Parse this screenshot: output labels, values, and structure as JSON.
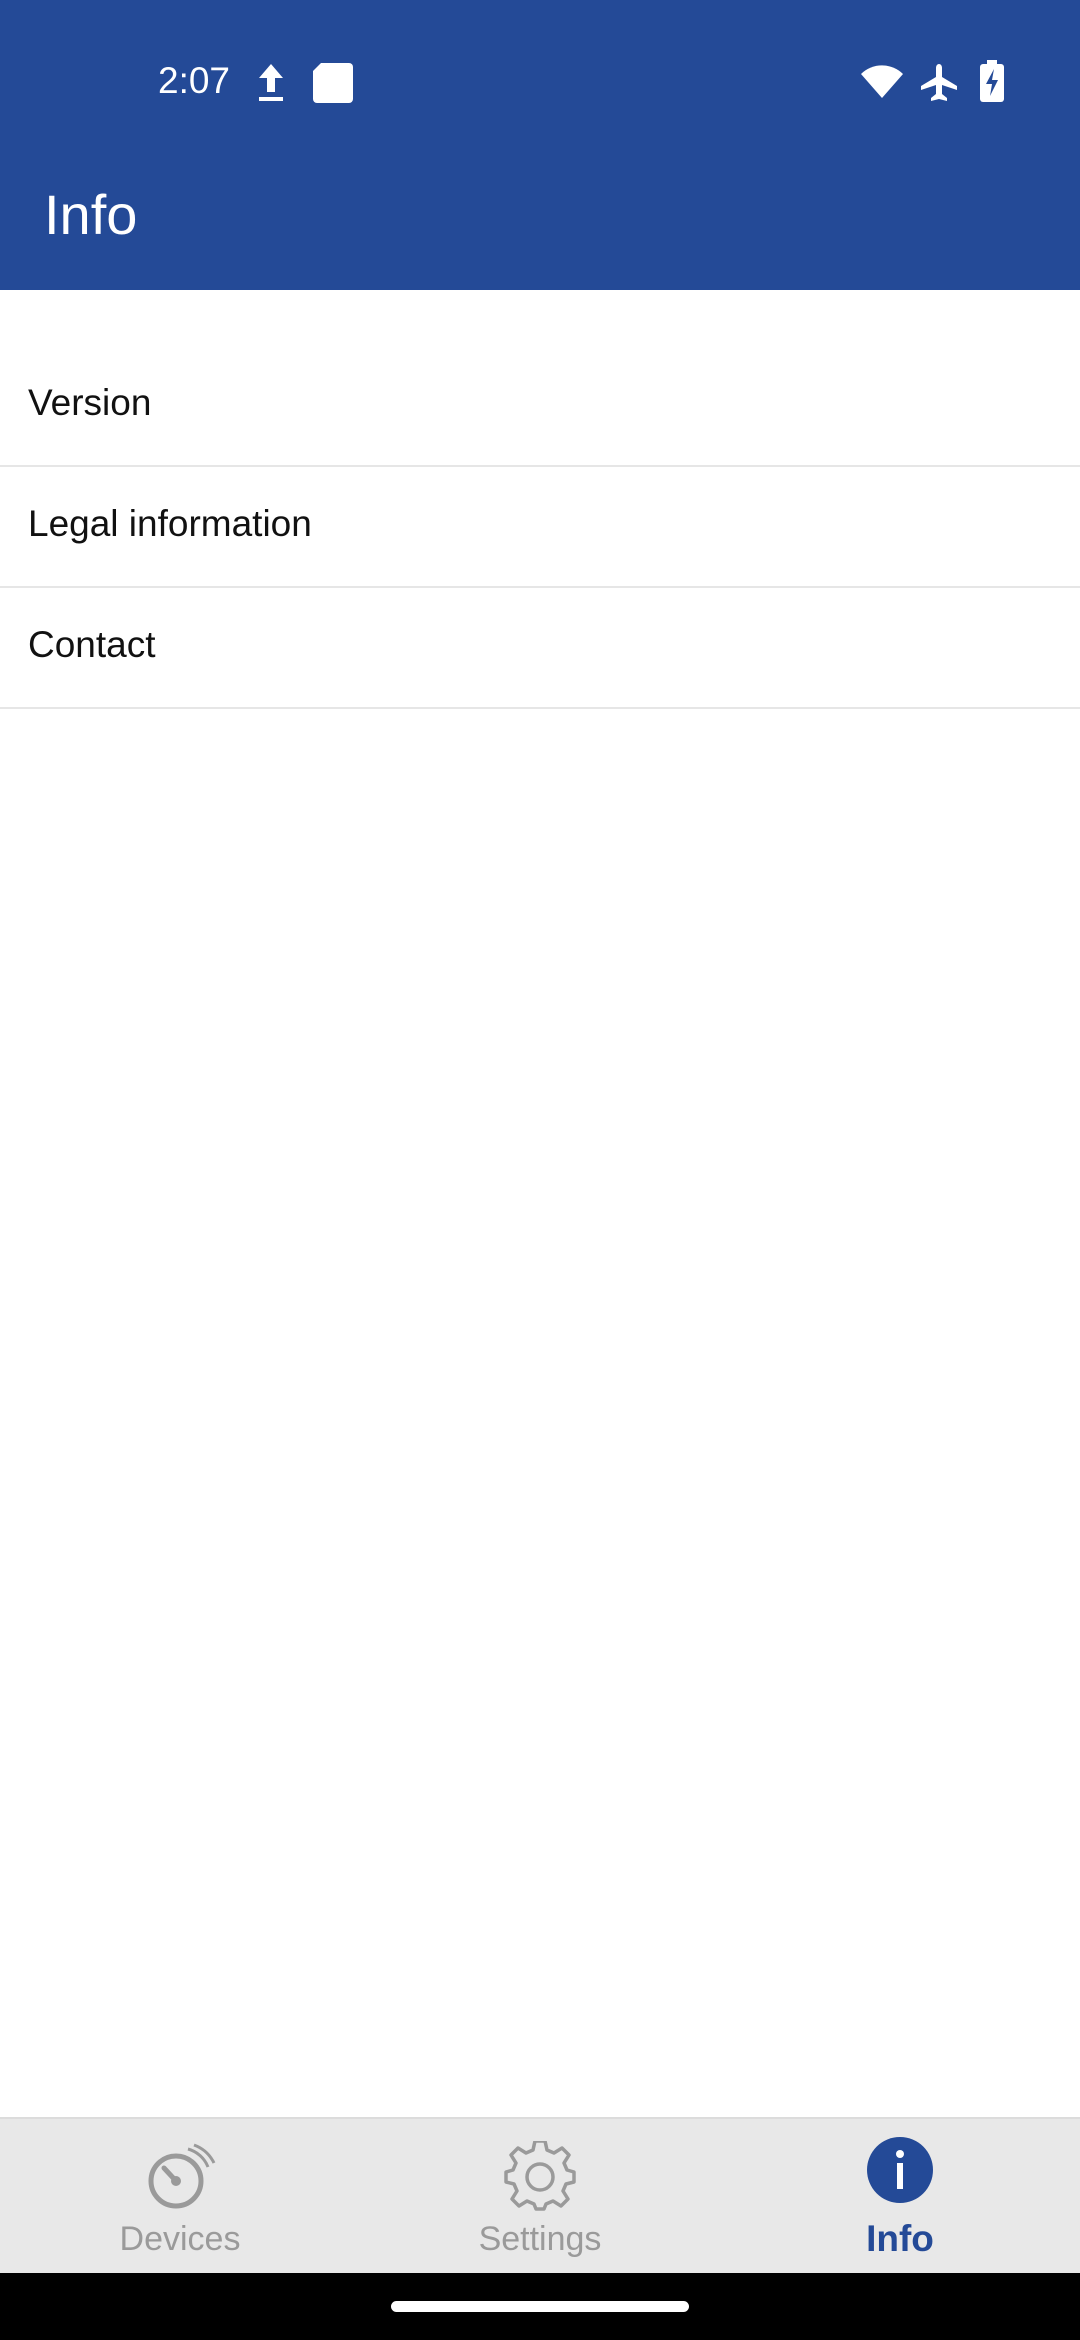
{
  "status_bar": {
    "time": "2:07",
    "icons": [
      "upload-icon",
      "sd-card-icon",
      "wifi-icon",
      "airplane-icon",
      "battery-charging-icon"
    ]
  },
  "header": {
    "title": "Info",
    "background_color": "#244a97"
  },
  "list": {
    "items": [
      {
        "label": "Version"
      },
      {
        "label": "Legal information"
      },
      {
        "label": "Contact"
      }
    ]
  },
  "bottom_nav": {
    "tabs": [
      {
        "label": "Devices",
        "icon": "gauge-icon",
        "active": false
      },
      {
        "label": "Settings",
        "icon": "gear-icon",
        "active": false
      },
      {
        "label": "Info",
        "icon": "info-icon",
        "active": true
      }
    ],
    "active_color": "#244a97",
    "inactive_color": "#9a9a9a"
  }
}
